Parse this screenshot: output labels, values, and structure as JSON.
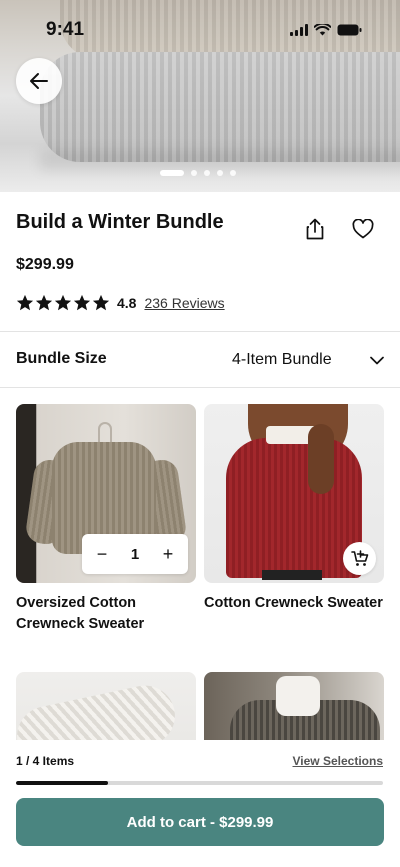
{
  "status_bar": {
    "time": "9:41"
  },
  "hero": {
    "image_description_icon": "folded-knit-sweaters",
    "carousel": {
      "total": 5,
      "active_index": 0
    }
  },
  "product": {
    "title": "Build a Winter Bundle",
    "price": "$299.99",
    "rating": {
      "stars": 5,
      "value": "4.8",
      "reviews_label": "236 Reviews"
    }
  },
  "bundle": {
    "label": "Bundle Size",
    "selected": "4-Item Bundle"
  },
  "items": [
    {
      "name": "Oversized Cotton Crewneck Sweater",
      "quantity": "1",
      "qty_minus": "−",
      "qty_plus": "+"
    },
    {
      "name": "Cotton Crewneck Sweater"
    },
    {
      "name": ""
    },
    {
      "name": ""
    }
  ],
  "footer": {
    "items_count": "1 / 4 Items",
    "view_selections": "View Selections",
    "progress": 0.25,
    "cart_button": "Add to cart - $299.99"
  },
  "colors": {
    "accent": "#4a8580",
    "text": "#111111",
    "divider": "#e3e3e3"
  },
  "icons": [
    "back-arrow-icon",
    "share-icon",
    "heart-icon",
    "star-icon",
    "chevron-down-icon",
    "add-to-cart-icon"
  ]
}
